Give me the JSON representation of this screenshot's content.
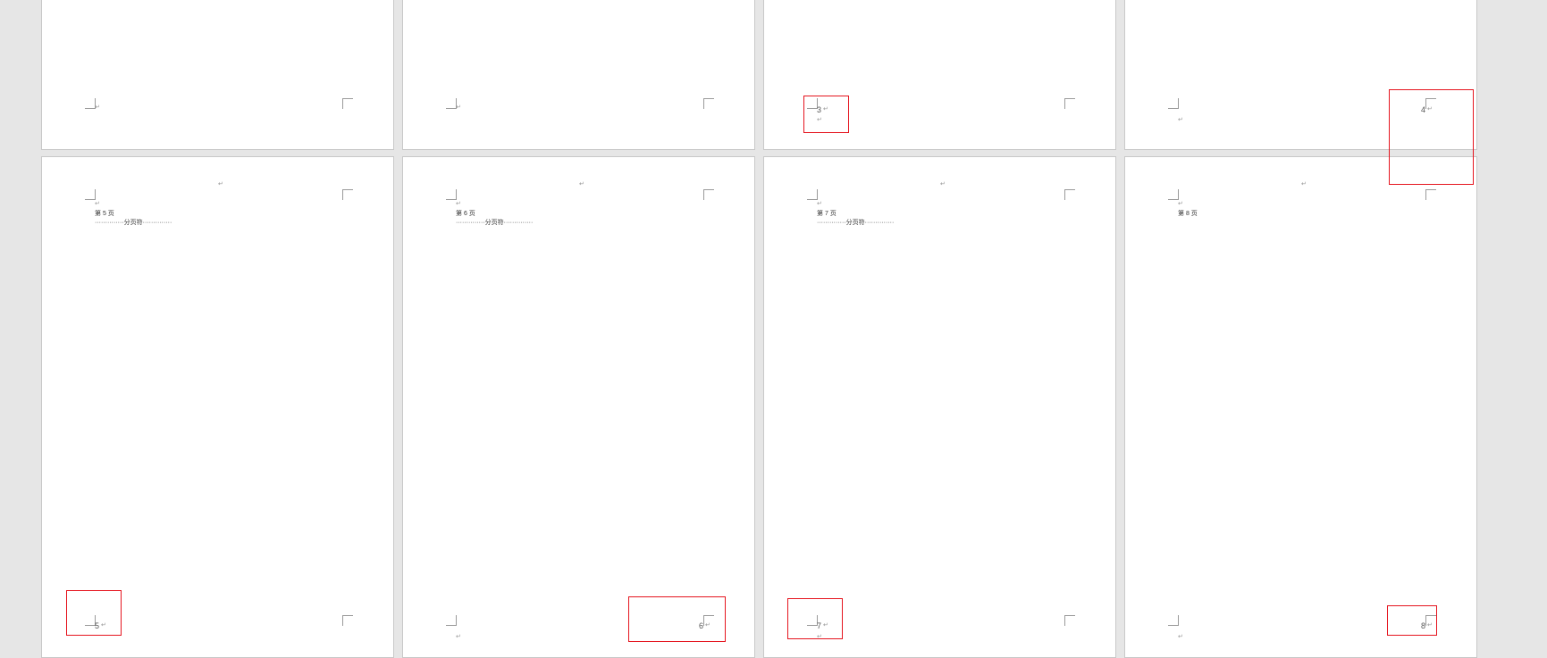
{
  "paragraph_mark": "↵",
  "pages_bottom": [
    {
      "heading": "第 5 页",
      "break_text": "··············分页符··············",
      "footer_num": "5"
    },
    {
      "heading": "第 6 页",
      "break_text": "··············分页符··············",
      "footer_num": "6"
    },
    {
      "heading": "第 7 页",
      "break_text": "··············分页符··············",
      "footer_num": "7"
    },
    {
      "heading": "第 8 页",
      "break_text": "",
      "footer_num": "8"
    }
  ],
  "pages_top": [
    {
      "footer_num": ""
    },
    {
      "footer_num": ""
    },
    {
      "footer_num": "3"
    },
    {
      "footer_num": "4"
    }
  ],
  "highlight_color": "#e5141e"
}
